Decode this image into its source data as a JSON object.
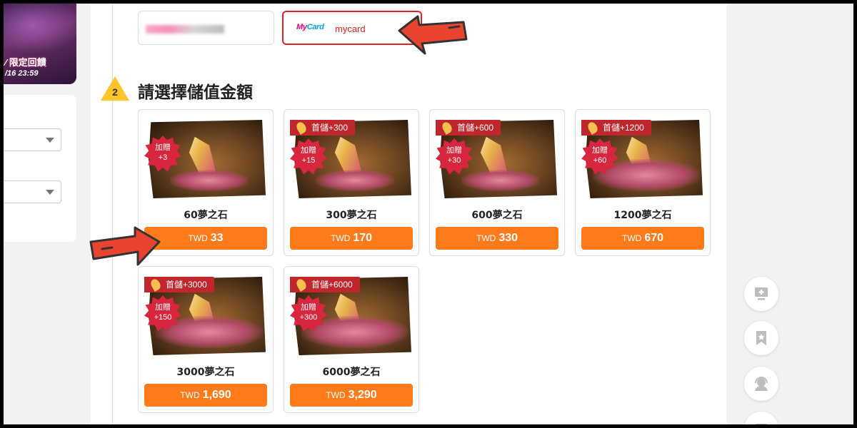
{
  "banner": {
    "promo_text": "⁄ 限定回饋",
    "date_text": "/16 23:59"
  },
  "payment": {
    "option1_name": "",
    "mycard_logo_part1": "My",
    "mycard_logo_part2": "Card",
    "option2_label": "mycard"
  },
  "step": {
    "number": "2",
    "title": "請選擇儲值金額"
  },
  "products": [
    {
      "name": "60夢之石",
      "currency": "TWD",
      "price": "33",
      "first_bonus": "",
      "extra_label": "加贈",
      "extra_value": "+3"
    },
    {
      "name": "300夢之石",
      "currency": "TWD",
      "price": "170",
      "first_bonus": "首儲+300",
      "extra_label": "加贈",
      "extra_value": "+15"
    },
    {
      "name": "600夢之石",
      "currency": "TWD",
      "price": "330",
      "first_bonus": "首儲+600",
      "extra_label": "加贈",
      "extra_value": "+30"
    },
    {
      "name": "1200夢之石",
      "currency": "TWD",
      "price": "670",
      "first_bonus": "首儲+1200",
      "extra_label": "加贈",
      "extra_value": "+60"
    },
    {
      "name": "3000夢之石",
      "currency": "TWD",
      "price": "1,690",
      "first_bonus": "首儲+3000",
      "extra_label": "加贈",
      "extra_value": "+150"
    },
    {
      "name": "6000夢之石",
      "currency": "TWD",
      "price": "3,290",
      "first_bonus": "首儲+6000",
      "extra_label": "加贈",
      "extra_value": "+300"
    }
  ],
  "icons": [
    "add-to-desktop-icon",
    "bookmark-icon",
    "customer-service-icon",
    "menu-icon"
  ],
  "colors": {
    "accent": "#ff7a1a",
    "ribbon": "#c0272d",
    "selected_border": "#e02020",
    "arrow": "#e8442f"
  }
}
